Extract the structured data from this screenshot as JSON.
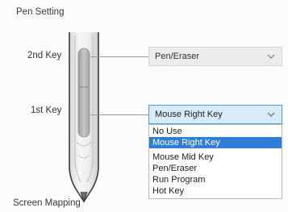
{
  "section": {
    "pen_setting": "Pen Setting",
    "screen_mapping": "Screen Mapping"
  },
  "keys": {
    "second": {
      "label": "2nd Key",
      "value": "Pen/Eraser"
    },
    "first": {
      "label": "1st Key",
      "value": "Mouse Right Key"
    }
  },
  "dropdown": {
    "options": [
      "No Use",
      "Mouse Right Key",
      "Mouse Mid Key",
      "Pen/Eraser",
      "Run Program",
      "Hot Key"
    ],
    "selected": "Mouse Right Key"
  },
  "icons": {
    "combo_arrow": "chevron-down-icon",
    "pen": "stylus-pen-icon"
  },
  "colors": {
    "selection": "#2f7dd6",
    "focused_combo_bg": "#d9ebf8",
    "focused_combo_border": "#4b9ede"
  }
}
